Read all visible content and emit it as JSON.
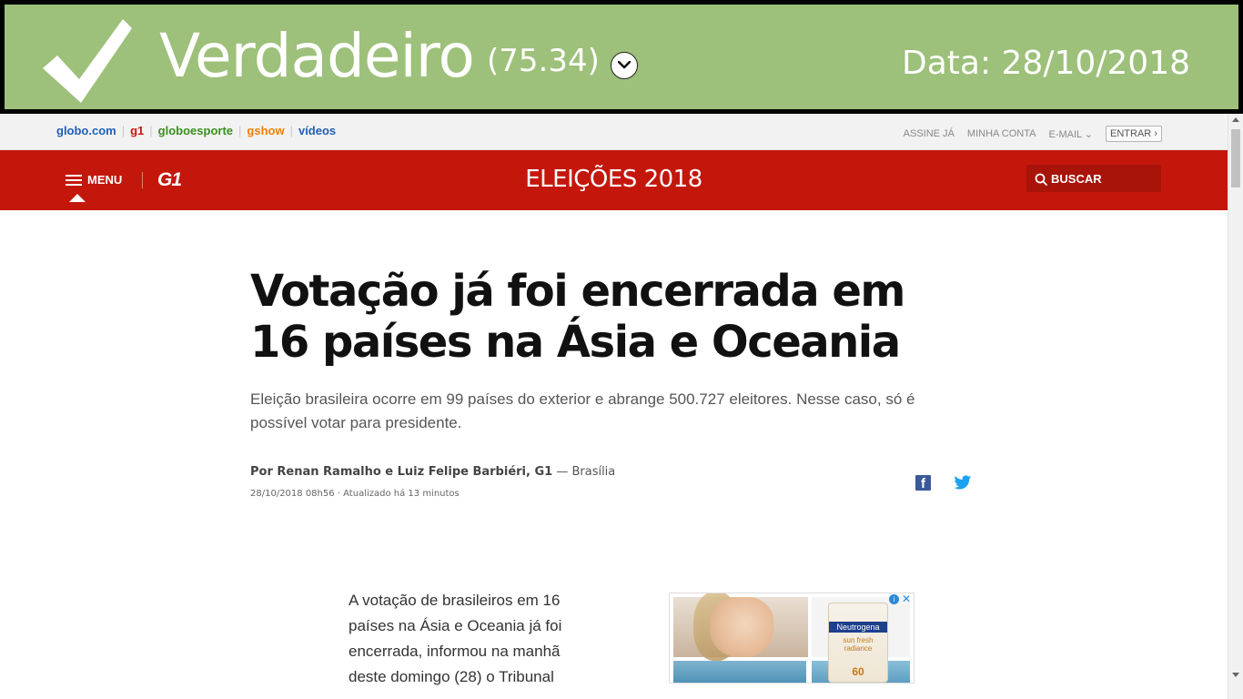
{
  "verdict": {
    "label": "Verdadeiro",
    "score": "(75.34)",
    "date": "Data: 28/10/2018",
    "background_color": "#9dc07a",
    "icon": "checkmark-icon",
    "toggle_icon": "chevron-down-icon"
  },
  "globo_bar": {
    "links": [
      "globo.com",
      "g1",
      "globoesporte",
      "gshow",
      "vídeos"
    ],
    "account": [
      "ASSINE JÁ",
      "MINHA CONTA",
      "E-MAIL"
    ],
    "entrar": "ENTRAR"
  },
  "header": {
    "menu_label": "MENU",
    "logo": "G1",
    "section_title": "ELEIÇÕES 2018",
    "search_label": "BUSCAR",
    "color": "#c4170c"
  },
  "article": {
    "headline": "Votação já foi encerrada em 16 países na Ásia e Oceania",
    "subhead": "Eleição brasileira ocorre em 99 países do exterior e abrange 500.727 eleitores. Nesse caso, só é possível votar para presidente.",
    "byline_authors": "Por Renan Ramalho e Luiz Felipe Barbiéri, G1",
    "byline_location": "— Brasília",
    "dateline": "28/10/2018 08h56 · Atualizado há 13 minutos",
    "body_first": "A votação de brasileiros em 16 países na Ásia e Oceania já foi encerrada, informou na manhã deste domingo (28) o Tribunal"
  },
  "ad": {
    "brand": "Neutrogena",
    "product": "sun fresh radiance",
    "spf": "60"
  }
}
